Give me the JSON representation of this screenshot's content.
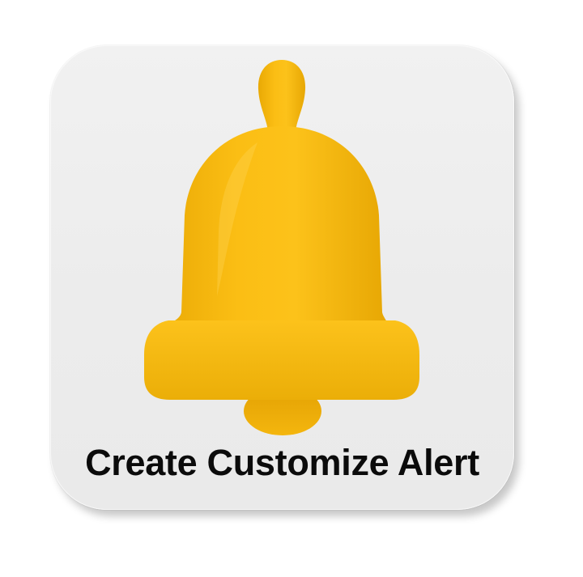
{
  "alert_tile": {
    "label": "Create Customize Alert",
    "icon": "bell-icon",
    "icon_color": "#F7B70F",
    "tile_color": "#EEEEEE",
    "text_color": "#0B0B0B"
  }
}
